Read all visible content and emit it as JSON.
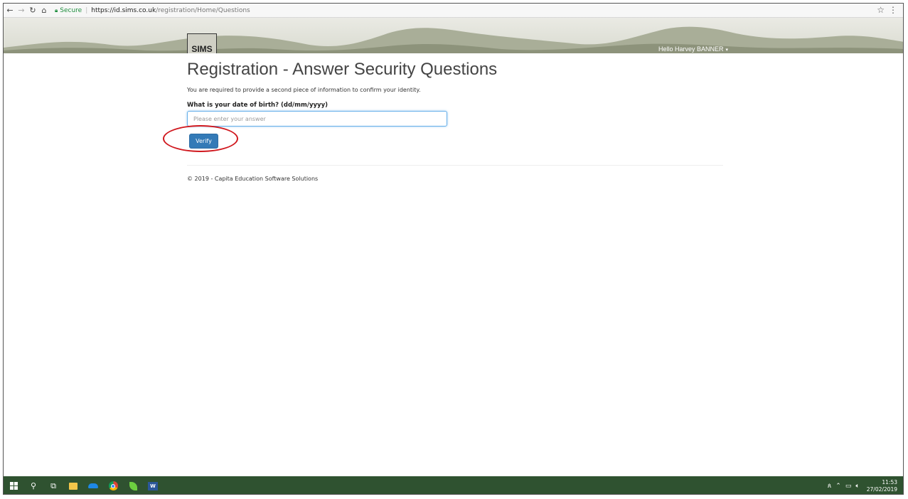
{
  "browser": {
    "secure_label": "Secure",
    "url_host": "https://id.sims.co.uk",
    "url_path": "/registration/Home/Questions"
  },
  "header": {
    "logo_text": "SIMS",
    "greeting": "Hello Harvey BANNER"
  },
  "page": {
    "title": "Registration - Answer Security Questions",
    "intro": "You are required to provide a second piece of information to confirm your identity.",
    "question_label": "What is your date of birth? (dd/mm/yyyy)",
    "answer_value": "",
    "answer_placeholder": "Please enter your answer",
    "verify_label": "Verify"
  },
  "footer": {
    "text": "© 2019 - Capita Education Software Solutions"
  },
  "taskbar": {
    "word_label": "W",
    "time": "11:53",
    "date": "27/02/2019"
  },
  "colors": {
    "primary_button": "#337ab7",
    "highlight": "#d0181e",
    "taskbar": "#2f5230"
  },
  "icons": [
    "back-icon",
    "forward-icon",
    "reload-icon",
    "home-icon",
    "lock-icon",
    "star-icon",
    "menu-icon",
    "windows-start-icon",
    "search-icon",
    "task-view-icon",
    "file-explorer-icon",
    "onedrive-icon",
    "chrome-icon",
    "leaf-app-icon",
    "word-icon",
    "people-icon",
    "chevron-up-icon",
    "network-icon",
    "volume-icon"
  ]
}
